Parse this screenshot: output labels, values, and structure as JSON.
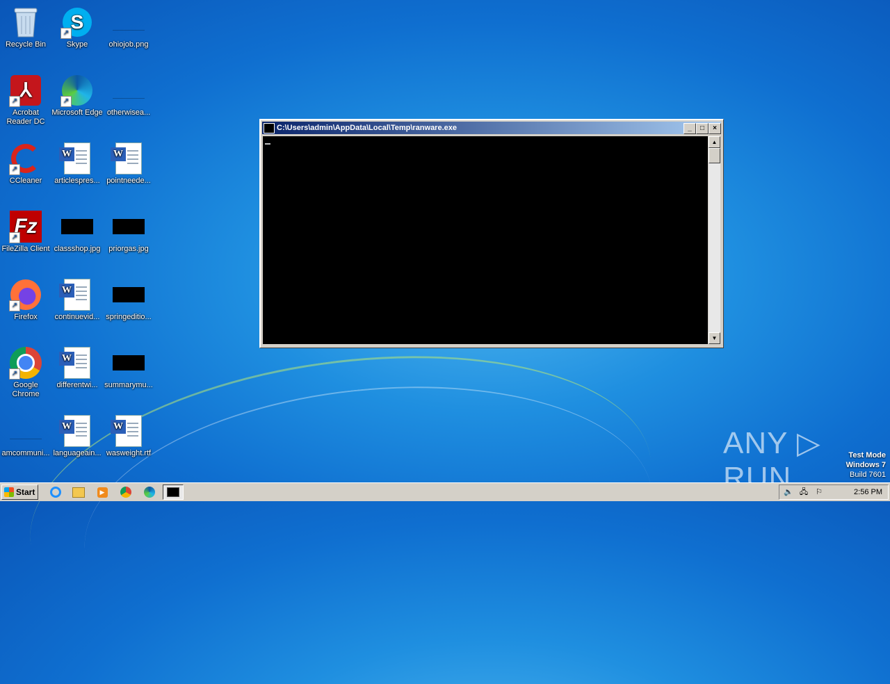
{
  "desktop": {
    "icons": [
      {
        "label": "Recycle Bin"
      },
      {
        "label": "Skype"
      },
      {
        "label": "ohiojob.png"
      },
      {
        "label": "Acrobat Reader DC"
      },
      {
        "label": "Microsoft Edge"
      },
      {
        "label": "otherwisea..."
      },
      {
        "label": "CCleaner"
      },
      {
        "label": "articlespres..."
      },
      {
        "label": "pointneede..."
      },
      {
        "label": "FileZilla Client"
      },
      {
        "label": "classshop.jpg"
      },
      {
        "label": "priorgas.jpg"
      },
      {
        "label": "Firefox"
      },
      {
        "label": "continuevid..."
      },
      {
        "label": "springeditio..."
      },
      {
        "label": "Google Chrome"
      },
      {
        "label": "differentwi..."
      },
      {
        "label": "summarymu..."
      },
      {
        "label": "amcommuni..."
      },
      {
        "label": "languageain..."
      },
      {
        "label": "wasweight.rtf"
      }
    ]
  },
  "console": {
    "title": "C:\\Users\\admin\\AppData\\Local\\Temp\\ranware.exe",
    "minimize": "_",
    "maximize": "□",
    "close": "×"
  },
  "watermark": {
    "text": "ANY ▷ RUN"
  },
  "test_mode": {
    "line1": "Test Mode",
    "line2": "Windows 7",
    "line3": "Build 7601"
  },
  "taskbar": {
    "start_label": "Start",
    "clock": "2:56 PM",
    "pinned": [
      "internet-explorer-icon",
      "file-explorer-icon",
      "media-player-icon",
      "chrome-icon",
      "edge-icon",
      "console-window-icon"
    ]
  },
  "colors": {
    "title_gradient_start": "#0a246a",
    "title_gradient_end": "#a6caf0",
    "console_bg": "#000000",
    "taskbar": "#d4d0c8"
  }
}
